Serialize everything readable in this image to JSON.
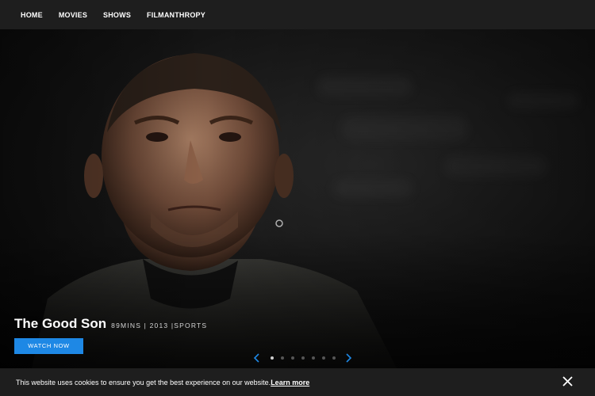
{
  "nav": {
    "items": [
      {
        "label": "HOME"
      },
      {
        "label": "MOVIES"
      },
      {
        "label": "SHOWS"
      },
      {
        "label": "FILMANTHROPY"
      }
    ]
  },
  "hero": {
    "title": "The Good Son",
    "meta": "89MINS | 2013 |SPORTS",
    "watch_label": "WATCH NOW",
    "slide_count": 7,
    "active_slide": 1
  },
  "cookie": {
    "text": "This website uses cookies to ensure you get the best experience on our website.",
    "link_label": "Learn more"
  },
  "colors": {
    "accent": "#1e88e5",
    "bar_bg": "#1e1e1e"
  },
  "icons": {
    "prev": "chevron-left-icon",
    "next": "chevron-right-icon",
    "close": "close-icon"
  }
}
